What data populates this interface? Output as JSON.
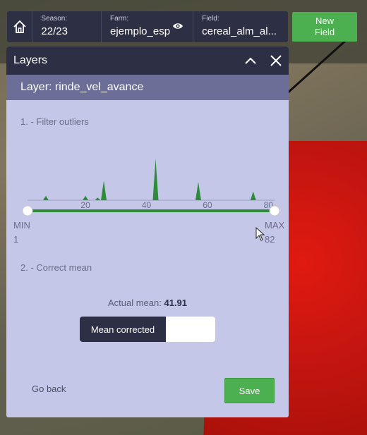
{
  "topbar": {
    "season": {
      "label": "Season:",
      "value": "22/23"
    },
    "farm": {
      "label": "Farm:",
      "value": "ejemplo_esp"
    },
    "field": {
      "label": "Field:",
      "value": "cereal_alm_al..."
    },
    "new_field_label_line1": "New",
    "new_field_label_line2": "Field",
    "icons": [
      "home-icon",
      "eye-icon"
    ]
  },
  "panel": {
    "title": "Layers",
    "layer_name": "Layer: rinde_vel_avance",
    "filter_title": "1. - Filter outliers",
    "correct_title": "2. - Correct mean",
    "min_label": "MIN",
    "min_value": "1",
    "max_label": "MAX",
    "max_value": "82",
    "mean_prefix": "Actual mean:",
    "mean_value": "41.91",
    "toggle_label": "Mean corrected",
    "go_back_label": "Go back",
    "save_label": "Save"
  },
  "chart_data": {
    "type": "area",
    "x_ticks": [
      "20",
      "40",
      "60",
      "80"
    ],
    "xlim": [
      1,
      82
    ],
    "peaks": [
      {
        "x": 7,
        "h": 0.1
      },
      {
        "x": 20,
        "h": 0.1
      },
      {
        "x": 24,
        "h": 0.06
      },
      {
        "x": 26,
        "h": 0.45
      },
      {
        "x": 43,
        "h": 0.95
      },
      {
        "x": 57,
        "h": 0.42
      },
      {
        "x": 75,
        "h": 0.2
      }
    ],
    "fill_color": "#2e8b3a",
    "slider_range": [
      1,
      82
    ]
  },
  "colors": {
    "accent": "#4caf50",
    "panel_dark": "#2d2f45",
    "panel_bg": "#c5c7e9",
    "layer_bar": "#6b6e96"
  }
}
